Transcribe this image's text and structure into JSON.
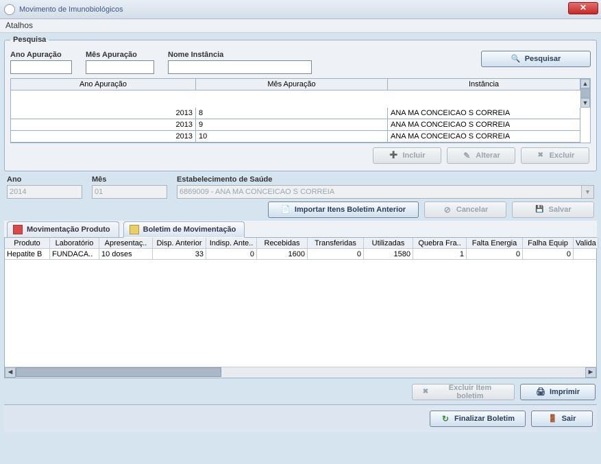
{
  "window": {
    "title": "Movimento de Imunobiológicos"
  },
  "menu": {
    "atalhos": "Atalhos"
  },
  "pesquisa": {
    "legend": "Pesquisa",
    "ano_label": "Ano Apuração",
    "mes_label": "Mês Apuração",
    "nome_label": "Nome Instância",
    "ano_value": "",
    "mes_value": "",
    "nome_value": "",
    "btn_pesquisar": "Pesquisar",
    "cols": {
      "ano": "Ano Apuração",
      "mes": "Mês Apuração",
      "inst": "Instância"
    },
    "rows": [
      {
        "ano": "2013",
        "mes": "8",
        "inst": "ANA MA CONCEICAO S CORREIA"
      },
      {
        "ano": "2013",
        "mes": "9",
        "inst": "ANA MA CONCEICAO S CORREIA"
      },
      {
        "ano": "2013",
        "mes": "10",
        "inst": "ANA MA CONCEICAO S CORREIA"
      }
    ],
    "btn_incluir": "Incluir",
    "btn_alterar": "Alterar",
    "btn_excluir": "Excluir"
  },
  "editor": {
    "ano_label": "Ano",
    "ano_value": "2014",
    "mes_label": "Mês",
    "mes_value": "01",
    "estab_label": "Estabelecimento de Saúde",
    "estab_value": "6869009 - ANA MA CONCEICAO S CORREIA",
    "btn_importar": "Importar Itens Boletim Anterior",
    "btn_cancelar": "Cancelar",
    "btn_salvar": "Salvar"
  },
  "tabs": {
    "mov": "Movimentação Produto",
    "bol": "Boletim de Movimentação"
  },
  "data_table": {
    "cols": {
      "produto": "Produto",
      "lab": "Laboratório",
      "apres": "Apresentaç..",
      "disp_ant": "Disp. Anterior",
      "indisp_ant": "Indisp. Ante..",
      "recebidas": "Recebidas",
      "transf": "Transferidas",
      "utilizadas": "Utilizadas",
      "quebra": "Quebra Fra..",
      "falta": "Falta Energia",
      "falha": "Falha Equip",
      "valida": "Valida"
    },
    "rows": [
      {
        "produto": "Hepatite B",
        "lab": "FUNDACA..",
        "apres": "10 doses",
        "disp_ant": "33",
        "indisp_ant": "0",
        "recebidas": "1600",
        "transf": "0",
        "utilizadas": "1580",
        "quebra": "1",
        "falta": "0",
        "falha": "0",
        "valida": ""
      }
    ]
  },
  "bottom": {
    "btn_excluir_item": "Excluir Item boletim",
    "btn_imprimir": "Imprimir"
  },
  "footer": {
    "btn_finalizar": "Finalizar Boletim",
    "btn_sair": "Sair"
  },
  "chart_data": {
    "type": "table",
    "title": "Boletim de Movimentação",
    "columns": [
      "Produto",
      "Laboratório",
      "Apresentação",
      "Disp. Anterior",
      "Indisp. Anterior",
      "Recebidas",
      "Transferidas",
      "Utilizadas",
      "Quebra Frasco",
      "Falta Energia",
      "Falha Equip"
    ],
    "rows": [
      [
        "Hepatite B",
        "FUNDACA..",
        "10 doses",
        33,
        0,
        1600,
        0,
        1580,
        1,
        0,
        0
      ]
    ]
  }
}
